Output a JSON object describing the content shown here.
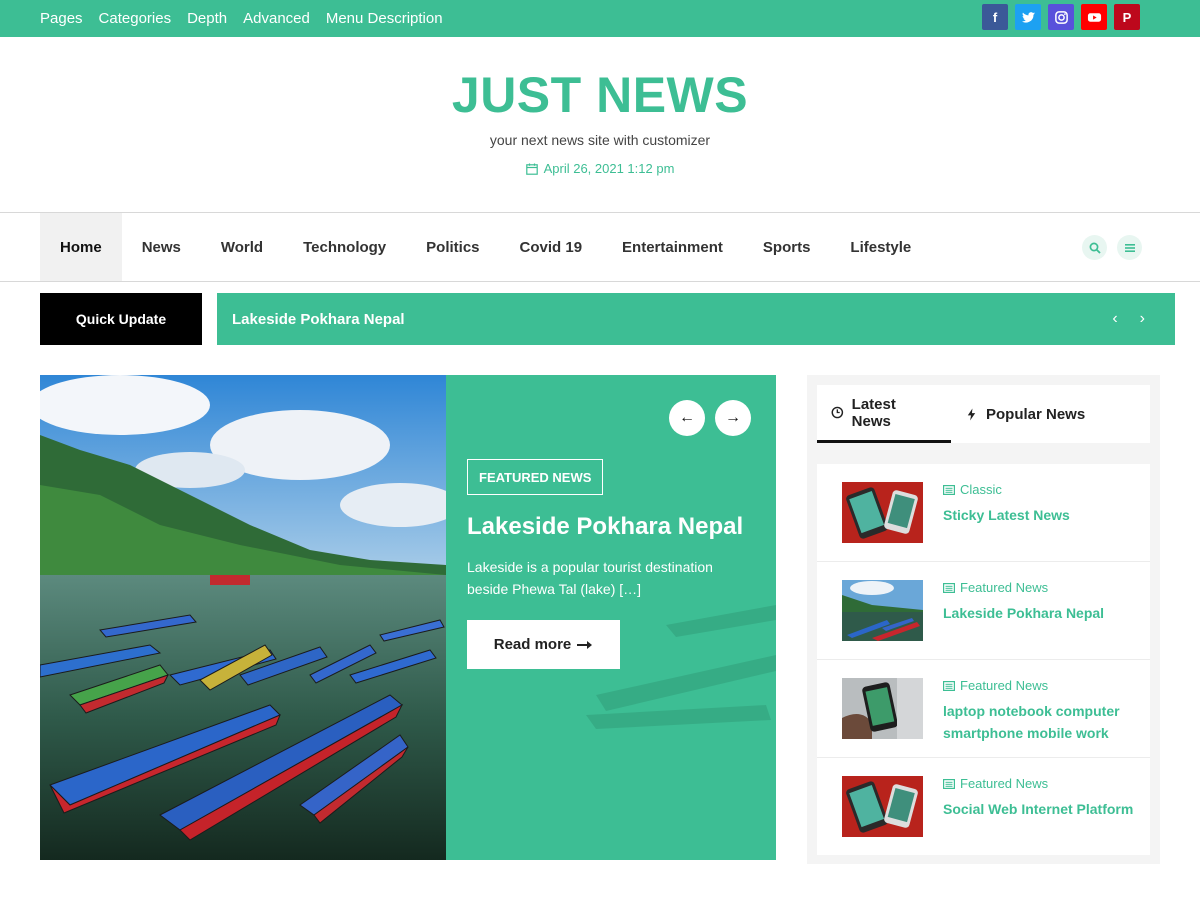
{
  "topbar": {
    "links": [
      "Pages",
      "Categories",
      "Depth",
      "Advanced",
      "Menu Description"
    ],
    "social": [
      {
        "icon": "facebook-icon",
        "color": "#3b5998",
        "glyph": "f"
      },
      {
        "icon": "twitter-icon",
        "color": "#1da1f2",
        "glyph": ""
      },
      {
        "icon": "instagram-icon",
        "color": "#5851db",
        "glyph": ""
      },
      {
        "icon": "youtube-icon",
        "color": "#ff0000",
        "glyph": ""
      },
      {
        "icon": "pinterest-icon",
        "color": "#bd081c",
        "glyph": "P"
      }
    ]
  },
  "header": {
    "title": "JUST NEWS",
    "tagline": "your next news site with customizer",
    "date": "April 26, 2021 1:12 pm"
  },
  "nav": {
    "items": [
      "Home",
      "News",
      "World",
      "Technology",
      "Politics",
      "Covid 19",
      "Entertainment",
      "Sports",
      "Lifestyle"
    ],
    "active": "Home"
  },
  "ticker": {
    "label": "Quick Update",
    "headline": "Lakeside Pokhara Nepal",
    "prev": "‹",
    "next": "›"
  },
  "featured": {
    "badge": "FEATURED NEWS",
    "title": "Lakeside Pokhara Nepal",
    "excerpt": "Lakeside is a popular tourist destination beside Phewa Tal (lake) […]",
    "read_more": "Read more",
    "prev": "←",
    "next": "→"
  },
  "sidebar": {
    "tabs": [
      "Latest News",
      "Popular News"
    ],
    "items": [
      {
        "category": "Classic",
        "title": "Sticky Latest News",
        "thumb": "phone"
      },
      {
        "category": "Featured News",
        "title": "Lakeside Pokhara Nepal",
        "thumb": "lake"
      },
      {
        "category": "Featured News",
        "title": "laptop notebook computer smartphone mobile work",
        "thumb": "hand"
      },
      {
        "category": "Featured News",
        "title": "Social Web Internet Platform",
        "thumb": "phone"
      }
    ]
  },
  "colors": {
    "accent": "#3dbe94",
    "dark": "#000000"
  }
}
